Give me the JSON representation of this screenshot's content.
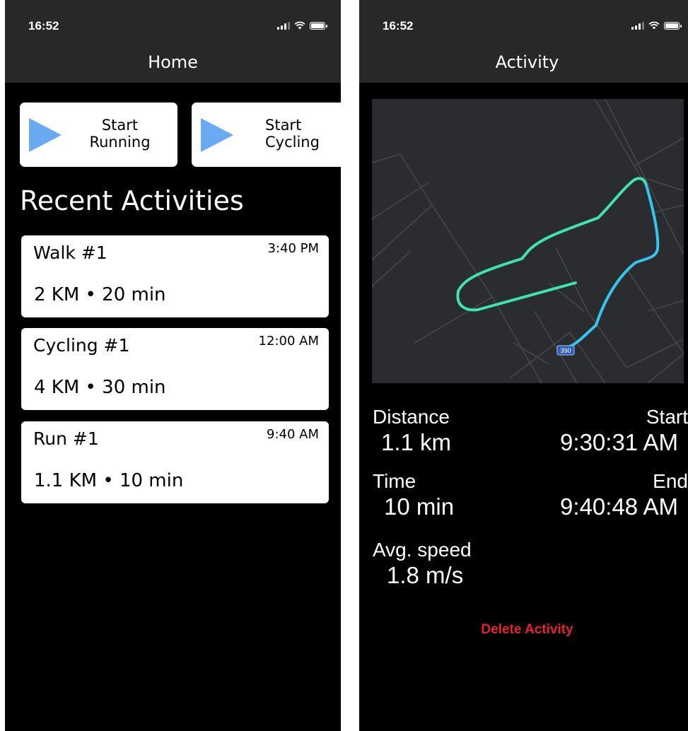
{
  "home": {
    "status_time": "16:52",
    "nav_title": "Home",
    "start_running_label": "Start\nRunning",
    "start_cycling_label": "Start\nCycling",
    "recent_title": "Recent Activities",
    "activities": [
      {
        "name": "Walk #1",
        "time": "3:40 PM",
        "summary": "2 KM • 20 min"
      },
      {
        "name": "Cycling #1",
        "time": "12:00 AM",
        "summary": "4 KM • 30 min"
      },
      {
        "name": "Run #1",
        "time": "9:40 AM",
        "summary": "1.1 KM • 10 min"
      }
    ]
  },
  "activity": {
    "status_time": "16:52",
    "nav_title": "Activity",
    "map_route_badge": "390",
    "distance_label": "Distance",
    "distance_value": "1.1 km",
    "time_label": "Time",
    "time_value": "10 min",
    "avg_speed_label": "Avg. speed",
    "avg_speed_value": "1.8 m/s",
    "start_label": "Start",
    "start_value": "9:30:31 AM",
    "end_label": "End",
    "end_value": "9:40:48 AM",
    "delete_label": "Delete Activity"
  },
  "colors": {
    "play_icon": "#6aaaf2",
    "route_green": "#3ee3b0",
    "route_blue": "#34c6ee",
    "delete": "#e8232b",
    "bar": "#282828"
  }
}
